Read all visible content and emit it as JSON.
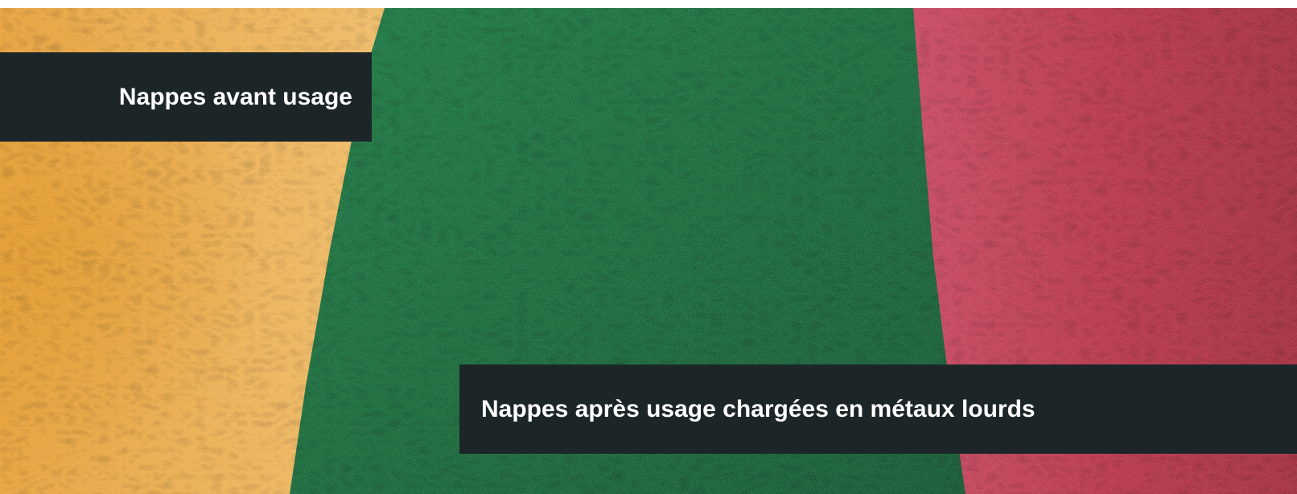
{
  "photo": {
    "subject": "felt-pads",
    "colors": {
      "before_pad": "#e9b660",
      "green_pad": "#1f6b3d",
      "red_pad": "#b8374b",
      "label_background": "#1c2628",
      "label_text": "#ffffff"
    }
  },
  "labels": {
    "before": "Nappes avant usage",
    "after": "Nappes après usage chargées en métaux lourds"
  }
}
